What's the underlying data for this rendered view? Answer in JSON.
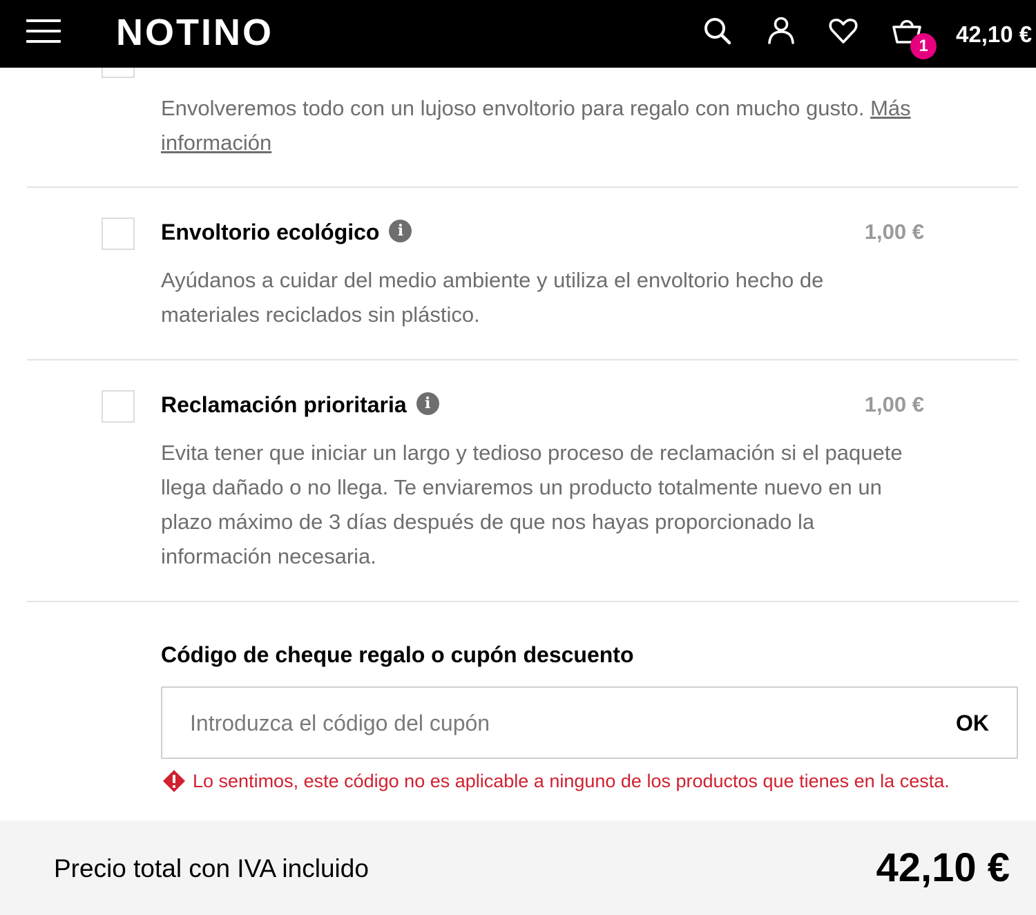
{
  "header": {
    "logo": "NOTINO",
    "cart_count": "1",
    "cart_total": "42,10 €",
    "icons": [
      "menu-icon",
      "search-icon",
      "user-icon",
      "heart-icon",
      "cart-icon"
    ]
  },
  "options": {
    "gift_wrap": {
      "description": "Envolveremos todo con un lujoso envoltorio para regalo con mucho gusto.",
      "more_info_link": "Más información"
    },
    "eco_wrap": {
      "title": "Envoltorio ecológico",
      "price": "1,00 €",
      "description": "Ayúdanos a cuidar del medio ambiente y utiliza el envoltorio hecho de materiales reciclados sin plástico."
    },
    "priority_claim": {
      "title": "Reclamación prioritaria",
      "price": "1,00 €",
      "description": "Evita tener que iniciar un largo y tedioso proceso de reclamación si el paquete llega dañado o no llega. Te enviaremos un producto totalmente nuevo en un plazo máximo de 3 días después de que nos hayas proporcionado la información necesaria."
    }
  },
  "coupon": {
    "title": "Código de cheque regalo o cupón descuento",
    "placeholder": "Introduzca el código del cupón",
    "ok_label": "OK",
    "error": "Lo sentimos, este código no es aplicable a ninguno de los productos que tienes en la cesta."
  },
  "footer": {
    "label": "Precio total con IVA incluido",
    "total": "42,10 €"
  },
  "colors": {
    "header_bg": "#000000",
    "badge": "#e6007e",
    "error": "#d1202f",
    "muted_text": "#6e6e6e",
    "footer_bg": "#f4f4f4"
  }
}
